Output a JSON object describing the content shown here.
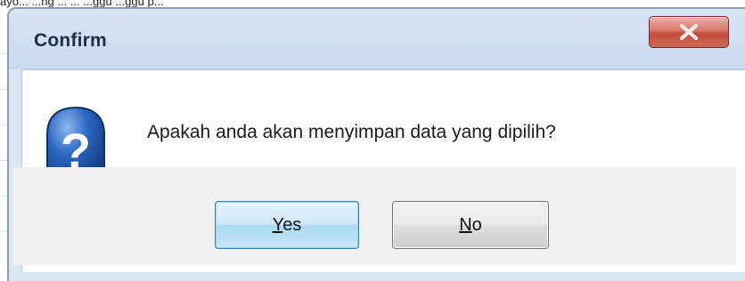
{
  "background": {
    "partial_text": "ayo... ...ng ... ... ...ggu ...ggu p..."
  },
  "dialog": {
    "title": "Confirm",
    "close_icon": "close-x-icon",
    "message_icon": "question-icon",
    "message": "Apakah anda akan menyimpan data yang dipilih?",
    "buttons": {
      "yes": {
        "label_mnemonic": "Y",
        "label_rest": "es"
      },
      "no": {
        "label_mnemonic": "N",
        "label_rest": "o"
      }
    }
  },
  "colors": {
    "title_text": "#1e2e46",
    "close_button": "#c24c3c",
    "yes_button_border": "#3c7fb1",
    "question_icon": "#1f55a8"
  }
}
